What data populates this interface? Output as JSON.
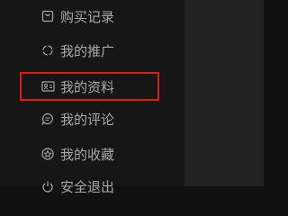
{
  "sidebar": {
    "items": [
      {
        "label": "购买记录",
        "icon": "bag-icon"
      },
      {
        "label": "我的推广",
        "icon": "share-circle-icon"
      },
      {
        "label": "我的资料",
        "icon": "id-card-icon"
      },
      {
        "label": "我的评论",
        "icon": "comment-icon"
      },
      {
        "label": "我的收藏",
        "icon": "star-icon"
      },
      {
        "label": "安全退出",
        "icon": "power-icon"
      }
    ]
  },
  "colors": {
    "sidebar_bg": "#161616",
    "content_bg": "#222222",
    "menu_text": "#a8a8a8",
    "highlight_border": "#e11919"
  }
}
